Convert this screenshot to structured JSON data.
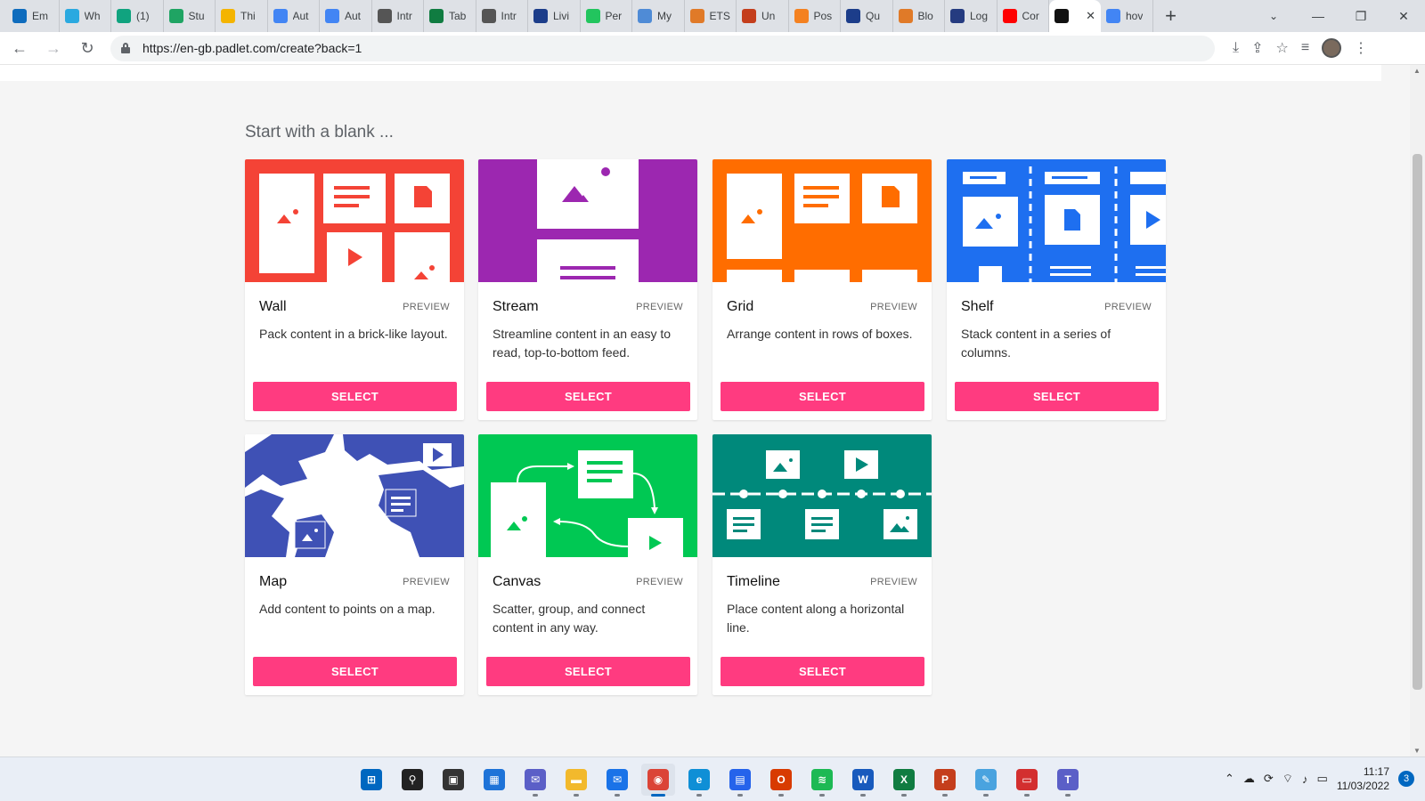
{
  "browser": {
    "tabs": [
      {
        "label": "Em",
        "color": "#0f6cbd"
      },
      {
        "label": "Wh",
        "color": "#2aa9e0"
      },
      {
        "label": "(1)",
        "color": "#10a37f"
      },
      {
        "label": "Stu",
        "color": "#1fa463"
      },
      {
        "label": "Thi",
        "color": "#f4b400"
      },
      {
        "label": "Aut",
        "color": "#4285f4"
      },
      {
        "label": "Aut",
        "color": "#4285f4"
      },
      {
        "label": "Intr",
        "color": "#555555"
      },
      {
        "label": "Tab",
        "color": "#107c41"
      },
      {
        "label": "Intr",
        "color": "#555555"
      },
      {
        "label": "Livi",
        "color": "#1c3d8a"
      },
      {
        "label": "Per",
        "color": "#22c55e"
      },
      {
        "label": "My",
        "color": "#4f8bd6"
      },
      {
        "label": "ETS",
        "color": "#e07a28"
      },
      {
        "label": "Un",
        "color": "#c43e1c"
      },
      {
        "label": "Pos",
        "color": "#f48120"
      },
      {
        "label": "Qu",
        "color": "#1c3d8a"
      },
      {
        "label": "Blo",
        "color": "#e07a28"
      },
      {
        "label": "Log",
        "color": "#253b80"
      },
      {
        "label": "Cor",
        "color": "#ff0000"
      }
    ],
    "active_tab": {
      "label": "",
      "close": "✕",
      "color": "#111111"
    },
    "last_tab": {
      "label": "hov",
      "color": "#4285f4"
    },
    "new_tab": "+",
    "tab_search": "⌄",
    "window_controls": {
      "minimize": "—",
      "restore": "❐",
      "close": "✕"
    },
    "back": "←",
    "forward": "→",
    "reload": "↻",
    "url": "https://en-gb.padlet.com/create?back=1",
    "tools": {
      "install": "⤓",
      "share": "⇪",
      "bookmark": "☆",
      "media": "≡",
      "menu": "⋮"
    }
  },
  "page": {
    "heading": "Start with a blank ...",
    "cards": [
      {
        "title": "Wall",
        "preview": "PREVIEW",
        "desc": "Pack content in a brick-like layout.",
        "select": "SELECT",
        "color": "#f44336"
      },
      {
        "title": "Stream",
        "preview": "PREVIEW",
        "desc": "Streamline content in an easy to read, top-to-bottom feed.",
        "select": "SELECT",
        "color": "#9c27b0"
      },
      {
        "title": "Grid",
        "preview": "PREVIEW",
        "desc": "Arrange content in rows of boxes.",
        "select": "SELECT",
        "color": "#ff6d00"
      },
      {
        "title": "Shelf",
        "preview": "PREVIEW",
        "desc": "Stack content in a series of columns.",
        "select": "SELECT",
        "color": "#1e6ff0"
      },
      {
        "title": "Map",
        "preview": "PREVIEW",
        "desc": "Add content to points on a map.",
        "select": "SELECT",
        "color": "#3f51b5"
      },
      {
        "title": "Canvas",
        "preview": "PREVIEW",
        "desc": "Scatter, group, and connect content in any way.",
        "select": "SELECT",
        "color": "#00c853"
      },
      {
        "title": "Timeline",
        "preview": "PREVIEW",
        "desc": "Place content along a horizontal line.",
        "select": "SELECT",
        "color": "#00897b"
      }
    ]
  },
  "taskbar": {
    "apps": [
      {
        "name": "start",
        "color": "#0067c0",
        "glyph": "⊞"
      },
      {
        "name": "search",
        "color": "#222222",
        "glyph": "⚲"
      },
      {
        "name": "task-view",
        "color": "#333333",
        "glyph": "▣"
      },
      {
        "name": "widgets",
        "color": "#1e73d8",
        "glyph": "▦"
      },
      {
        "name": "chat",
        "color": "#5b5fc7",
        "glyph": "✉"
      },
      {
        "name": "file-explorer",
        "color": "#f2b92c",
        "glyph": "▬"
      },
      {
        "name": "mail",
        "color": "#1a73e8",
        "glyph": "✉"
      },
      {
        "name": "chrome",
        "color": "#db4437",
        "glyph": "◉"
      },
      {
        "name": "edge",
        "color": "#0f8fd6",
        "glyph": "e"
      },
      {
        "name": "store",
        "color": "#2563eb",
        "glyph": "▤"
      },
      {
        "name": "office",
        "color": "#d83b01",
        "glyph": "O"
      },
      {
        "name": "spotify",
        "color": "#1db954",
        "glyph": "≋"
      },
      {
        "name": "word",
        "color": "#185abd",
        "glyph": "W"
      },
      {
        "name": "excel",
        "color": "#107c41",
        "glyph": "X"
      },
      {
        "name": "powerpoint",
        "color": "#c43e1c",
        "glyph": "P"
      },
      {
        "name": "paint",
        "color": "#4aa3df",
        "glyph": "✎"
      },
      {
        "name": "pdf",
        "color": "#d32f2f",
        "glyph": "▭"
      },
      {
        "name": "teams",
        "color": "#5b5fc7",
        "glyph": "T"
      }
    ],
    "active_app": "chrome",
    "tray": {
      "chevron": "⌃",
      "cloud": "☁",
      "sync": "⟳",
      "wifi": "⌔",
      "volume": "♪",
      "battery": "▭"
    },
    "time": "11:17",
    "date": "11/03/2022",
    "notifications": "3"
  },
  "scrollbar": {
    "up": "▲",
    "down": "▼"
  }
}
